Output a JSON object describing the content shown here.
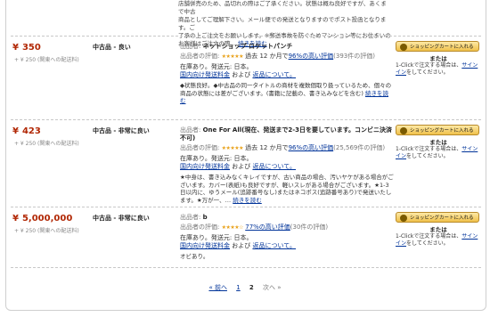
{
  "top": {
    "lines": [
      "店舗併売のため、品切れの際はご了承ください。状態は概ね良好ですが、あくまで中古",
      "商品としてご理解下さい。メール便での発送となりますのでポスト投函となります。ご",
      "了承の上ご注文をお願いします。※郵送事故を防ぐためマンション等にお住まいの",
      "お客様はご注文の際…"
    ],
    "more_link": "続きを読む"
  },
  "offers": [
    {
      "price": "350",
      "shipping": "+ ¥ 250 (関東への配送料)",
      "condition": "中古品 - 良い",
      "seller_label": "出品者:",
      "seller_name": "ネットショップ ロケットパンチ",
      "rating_label": "出品者の評価:",
      "stars": "★★★★★",
      "rating_period": "過去 12 か月で",
      "rating_link": "96%の高い評価",
      "rating_count": "(393件の評価)",
      "stock_text": "在庫あり。発送元: 日本。",
      "shipping_link": "国内向け発送料金",
      "and_text": "および",
      "returns_link": "返品について。",
      "description": "◆状態良好。◆中古品の同一タイトルの商材を複数個取り扱っているため、個々の商品の状態には差がございます。(書籍に記載の、書き込みなどを含む)",
      "more_link": "続きを読む"
    },
    {
      "price": "423",
      "shipping": "+ ¥ 250 (関東への配送料)",
      "condition": "中古品 - 非常に良い",
      "seller_label": "出品者:",
      "seller_name": "One For All(現在、発送まで2-3日を要しています。コンビニ決済不可)",
      "rating_label": "出品者の評価:",
      "stars": "★★★★★",
      "rating_period": "過去 12 か月で",
      "rating_link": "96%の高い評価",
      "rating_count": "(25,569件の評価)",
      "stock_text": "在庫あり。発送元: 日本。",
      "shipping_link": "国内向け発送料金",
      "and_text": "および",
      "returns_link": "返品について。",
      "description": "★中身は、書き込みなくキレイですが、古い商品の場合、汚いヤケがある場合がございます。カバー(表紙)も良好ですが、軽いスレがある場合がございます。★1-3日以内に、ゆうメール(追跡番号なし)またはネコポス(追跡番号あり)で発送いたします。★万が一、…",
      "more_link": "続きを読む"
    },
    {
      "price": "5,000,000",
      "shipping": "+ ¥ 250 (関東への配送料)",
      "condition": "中古品 - 非常に良い",
      "seller_label": "出品者:",
      "seller_name": "b",
      "rating_label": "出品者の評価:",
      "stars": "★★★★☆",
      "rating_period": "",
      "rating_link": "77%の高い評価",
      "rating_count": "(30件の評価)",
      "stock_text": "在庫あり。発送元: 日本。",
      "shipping_link": "国内向け発送料金",
      "and_text": "および",
      "returns_link": "返品について。",
      "description": "オビあり。",
      "more_link": ""
    }
  ],
  "cart": {
    "button_label": "ショッピングカートに入れる",
    "or_label": "または",
    "oneclick_prefix": "1-Clickで注文する場合は、",
    "signin_link": "サインイン",
    "oneclick_suffix": "をしてください。"
  },
  "pager": {
    "prev": "« 前へ",
    "page1": "1",
    "page2": "2",
    "next": "次へ »"
  }
}
